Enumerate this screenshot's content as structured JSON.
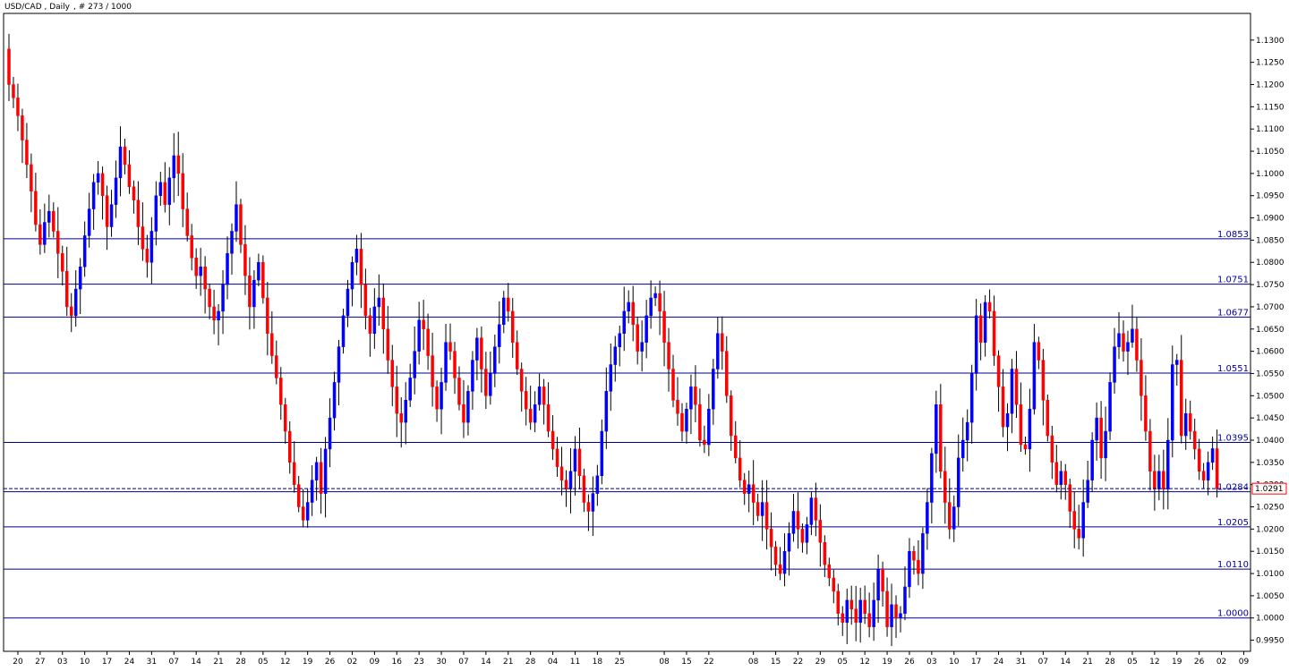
{
  "chart_data": {
    "type": "candlestick",
    "title": "USD/CAD , Daily",
    "subtitle": ", # 273 / 1000",
    "ylim": [
      0.9925,
      1.136
    ],
    "y_ticks": [
      "1.1300",
      "1.1250",
      "1.1200",
      "1.1150",
      "1.1100",
      "1.1050",
      "1.1000",
      "1.0950",
      "1.0900",
      "1.0850",
      "1.0800",
      "1.0750",
      "1.0700",
      "1.0650",
      "1.0600",
      "1.0550",
      "1.0500",
      "1.0450",
      "1.0400",
      "1.0350",
      "1.0300",
      "1.0250",
      "1.0200",
      "1.0150",
      "1.0100",
      "1.0050",
      "1.0000",
      "0.9950"
    ],
    "x_labels": [
      {
        "label": "20",
        "i": 2
      },
      {
        "label": "27",
        "i": 7
      },
      {
        "label": "03",
        "i": 12
      },
      {
        "label": "10",
        "i": 17
      },
      {
        "label": "17",
        "i": 22
      },
      {
        "label": "24",
        "i": 27
      },
      {
        "label": "31",
        "i": 32
      },
      {
        "label": "07",
        "i": 37
      },
      {
        "label": "14",
        "i": 42
      },
      {
        "label": "21",
        "i": 47
      },
      {
        "label": "28",
        "i": 52
      },
      {
        "label": "05",
        "i": 57
      },
      {
        "label": "12",
        "i": 62
      },
      {
        "label": "19",
        "i": 67
      },
      {
        "label": "26",
        "i": 72
      },
      {
        "label": "02",
        "i": 77
      },
      {
        "label": "09",
        "i": 82
      },
      {
        "label": "16",
        "i": 87
      },
      {
        "label": "23",
        "i": 92
      },
      {
        "label": "30",
        "i": 97
      },
      {
        "label": "07",
        "i": 102
      },
      {
        "label": "14",
        "i": 107
      },
      {
        "label": "21",
        "i": 112
      },
      {
        "label": "28",
        "i": 117
      },
      {
        "label": "04",
        "i": 122
      },
      {
        "label": "11",
        "i": 127
      },
      {
        "label": "18",
        "i": 132
      },
      {
        "label": "25",
        "i": 137
      },
      {
        "label": "08",
        "i": 147
      },
      {
        "label": "15",
        "i": 152
      },
      {
        "label": "22",
        "i": 157
      },
      {
        "label": "08",
        "i": 167
      },
      {
        "label": "15",
        "i": 172
      },
      {
        "label": "22",
        "i": 177
      },
      {
        "label": "29",
        "i": 182
      },
      {
        "label": "05",
        "i": 187
      },
      {
        "label": "12",
        "i": 192
      },
      {
        "label": "19",
        "i": 197
      },
      {
        "label": "26",
        "i": 202
      },
      {
        "label": "03",
        "i": 207
      },
      {
        "label": "10",
        "i": 212
      },
      {
        "label": "17",
        "i": 217
      },
      {
        "label": "24",
        "i": 222
      },
      {
        "label": "31",
        "i": 227
      },
      {
        "label": "07",
        "i": 232
      },
      {
        "label": "14",
        "i": 237
      },
      {
        "label": "21",
        "i": 242
      },
      {
        "label": "28",
        "i": 247
      },
      {
        "label": "05",
        "i": 252
      },
      {
        "label": "12",
        "i": 257
      },
      {
        "label": "19",
        "i": 262
      },
      {
        "label": "26",
        "i": 267
      },
      {
        "label": "02",
        "i": 272
      },
      {
        "label": "09",
        "i": 277
      }
    ],
    "levels": [
      {
        "value": 1.0853,
        "label": "1.0853"
      },
      {
        "value": 1.0751,
        "label": "1.0751"
      },
      {
        "value": 1.0677,
        "label": "1.0677"
      },
      {
        "value": 1.0551,
        "label": "1.0551"
      },
      {
        "value": 1.0395,
        "label": "1.0395"
      },
      {
        "value": 1.0284,
        "label": "1.0284"
      },
      {
        "value": 1.0205,
        "label": "1.0205"
      },
      {
        "value": 1.011,
        "label": "1.0110"
      },
      {
        "value": 1.0,
        "label": "1.0000"
      }
    ],
    "current_price": {
      "value": 1.0291,
      "label": "1.0291"
    },
    "closes": [
      1.12,
      1.117,
      1.113,
      1.1075,
      1.102,
      1.096,
      1.0885,
      1.084,
      1.089,
      1.0915,
      1.087,
      1.082,
      1.078,
      1.07,
      1.068,
      1.074,
      1.079,
      1.086,
      1.092,
      1.098,
      1.1,
      1.095,
      1.088,
      1.093,
      1.099,
      1.106,
      1.102,
      1.097,
      1.094,
      1.088,
      1.083,
      1.08,
      1.087,
      1.095,
      1.098,
      1.093,
      1.099,
      1.104,
      1.1,
      1.092,
      1.086,
      1.081,
      1.077,
      1.079,
      1.074,
      1.07,
      1.067,
      1.069,
      1.075,
      1.082,
      1.087,
      1.093,
      1.084,
      1.077,
      1.07,
      1.076,
      1.08,
      1.072,
      1.064,
      1.059,
      1.054,
      1.048,
      1.042,
      1.035,
      1.03,
      1.025,
      1.022,
      1.026,
      1.031,
      1.035,
      1.028,
      1.038,
      1.045,
      1.053,
      1.061,
      1.068,
      1.074,
      1.08,
      1.083,
      1.075,
      1.068,
      1.064,
      1.07,
      1.072,
      1.065,
      1.058,
      1.052,
      1.046,
      1.044,
      1.049,
      1.054,
      1.06,
      1.067,
      1.065,
      1.059,
      1.052,
      1.047,
      1.053,
      1.062,
      1.06,
      1.054,
      1.048,
      1.044,
      1.051,
      1.058,
      1.063,
      1.056,
      1.05,
      1.055,
      1.061,
      1.066,
      1.072,
      1.069,
      1.062,
      1.056,
      1.051,
      1.047,
      1.044,
      1.048,
      1.052,
      1.048,
      1.042,
      1.038,
      1.034,
      1.031,
      1.029,
      1.033,
      1.038,
      1.032,
      1.026,
      1.024,
      1.028,
      1.032,
      1.042,
      1.051,
      1.057,
      1.061,
      1.064,
      1.069,
      1.071,
      1.066,
      1.06,
      1.062,
      1.068,
      1.072,
      1.073,
      1.069,
      1.062,
      1.056,
      1.049,
      1.046,
      1.042,
      1.047,
      1.052,
      1.048,
      1.04,
      1.039,
      1.047,
      1.056,
      1.064,
      1.06,
      1.05,
      1.041,
      1.036,
      1.031,
      1.028,
      1.03,
      1.026,
      1.023,
      1.026,
      1.02,
      1.016,
      1.012,
      1.01,
      1.015,
      1.019,
      1.024,
      1.02,
      1.017,
      1.021,
      1.027,
      1.022,
      1.017,
      1.012,
      1.009,
      1.006,
      1.001,
      0.999,
      1.004,
      1.002,
      0.999,
      1.004,
      1.001,
      0.998,
      1.004,
      1.011,
      1.006,
      0.998,
      1.003,
      1.0,
      1.001,
      1.007,
      1.015,
      1.013,
      1.01,
      1.019,
      1.026,
      1.037,
      1.048,
      1.033,
      1.026,
      1.02,
      1.025,
      1.036,
      1.04,
      1.044,
      1.055,
      1.068,
      1.062,
      1.071,
      1.069,
      1.059,
      1.052,
      1.043,
      1.046,
      1.056,
      1.048,
      1.039,
      1.038,
      1.047,
      1.062,
      1.058,
      1.049,
      1.041,
      1.035,
      1.03,
      1.033,
      1.03,
      1.024,
      1.02,
      1.018,
      1.026,
      1.031,
      1.04,
      1.045,
      1.036,
      1.042,
      1.053,
      1.061,
      1.064,
      1.06,
      1.062,
      1.065,
      1.058,
      1.05,
      1.042,
      1.033,
      1.029,
      1.033,
      1.029,
      1.04,
      1.057,
      1.058,
      1.041,
      1.046,
      1.042,
      1.038,
      1.033,
      1.031,
      1.035,
      1.0381,
      1.0291
    ]
  }
}
